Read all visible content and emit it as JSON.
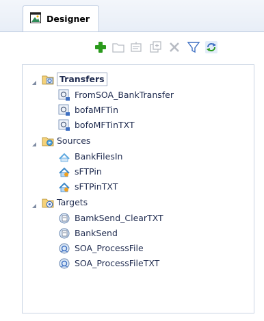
{
  "tab": {
    "label": "Designer",
    "icon": "designer-icon"
  },
  "toolbar": {
    "buttons": [
      {
        "name": "add-icon",
        "color": "#2a9a1c"
      },
      {
        "name": "folder-icon",
        "color": "#b8bcc4"
      },
      {
        "name": "edit-icon",
        "color": "#b8bcc4"
      },
      {
        "name": "duplicate-icon",
        "color": "#b8bcc4"
      },
      {
        "name": "delete-icon",
        "color": "#b8bcc4"
      },
      {
        "name": "filter-icon",
        "color": "#3d6fc2"
      },
      {
        "name": "refresh-icon",
        "color": "#3d6fc2"
      }
    ]
  },
  "tree": {
    "groups": [
      {
        "label": "Transfers",
        "icon": "transfers-folder-icon",
        "selected": true,
        "items": [
          {
            "label": "FromSOA_BankTransfer",
            "icon": "transfer-icon"
          },
          {
            "label": "bofaMFTin",
            "icon": "transfer-icon"
          },
          {
            "label": "bofoMFTinTXT",
            "icon": "transfer-icon"
          }
        ]
      },
      {
        "label": "Sources",
        "icon": "sources-folder-icon",
        "selected": false,
        "items": [
          {
            "label": "BankFilesIn",
            "icon": "source-icon"
          },
          {
            "label": "sFTPin",
            "icon": "source-home-icon"
          },
          {
            "label": "sFTPinTXT",
            "icon": "source-home-icon"
          }
        ]
      },
      {
        "label": "Targets",
        "icon": "targets-folder-icon",
        "selected": false,
        "items": [
          {
            "label": "BamkSend_ClearTXT",
            "icon": "target-icon"
          },
          {
            "label": "BankSend",
            "icon": "target-icon"
          },
          {
            "label": "SOA_ProcessFile",
            "icon": "target-soa-icon"
          },
          {
            "label": "SOA_ProcessFileTXT",
            "icon": "target-soa-icon"
          }
        ]
      }
    ]
  }
}
